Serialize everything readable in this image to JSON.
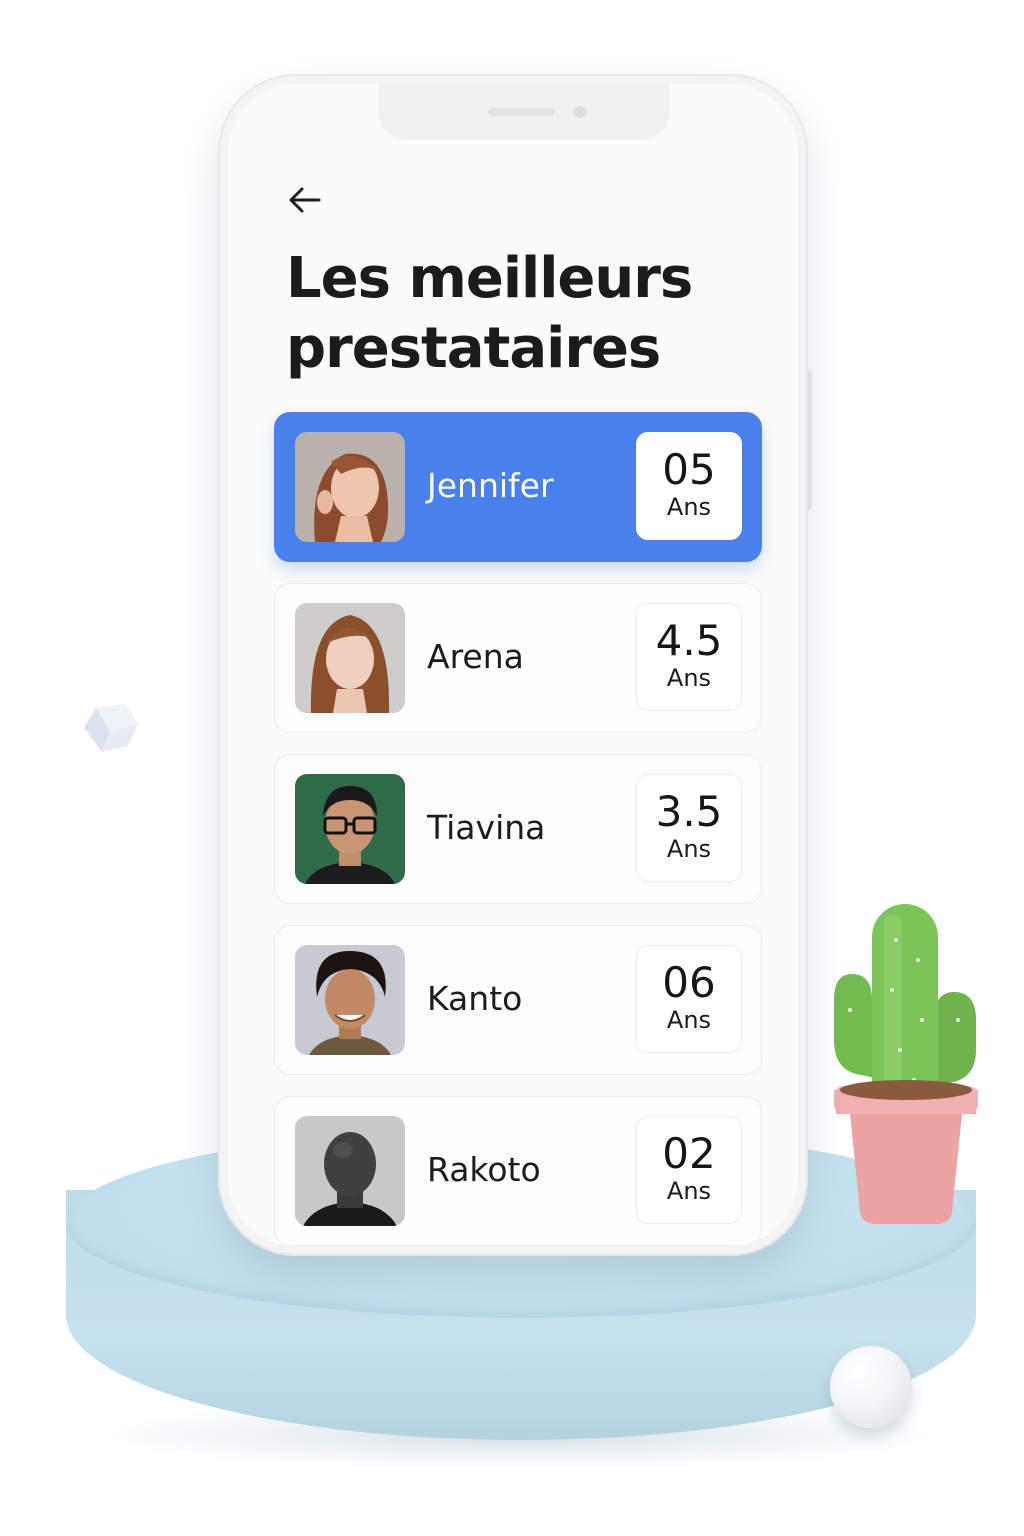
{
  "header": {
    "back_icon": "arrow-left-icon",
    "title": "Les meilleurs prestataires"
  },
  "providers": [
    {
      "name": "Jennifer",
      "years": "05",
      "unit": "Ans",
      "selected": true
    },
    {
      "name": "Arena",
      "years": "4.5",
      "unit": "Ans",
      "selected": false
    },
    {
      "name": "Tiavina",
      "years": "3.5",
      "unit": "Ans",
      "selected": false
    },
    {
      "name": "Kanto",
      "years": "06",
      "unit": "Ans",
      "selected": false
    },
    {
      "name": "Rakoto",
      "years": "02",
      "unit": "Ans",
      "selected": false
    }
  ],
  "colors": {
    "accent": "#4a80ec",
    "pedestal": "#c3e0ee",
    "cactus": "#72b94c",
    "pot": "#e9a0a0"
  }
}
